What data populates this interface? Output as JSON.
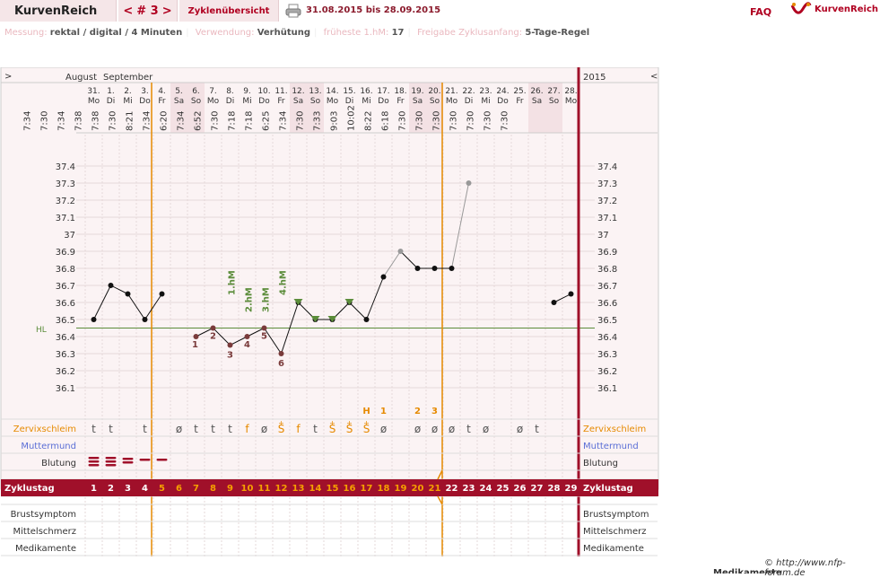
{
  "app": {
    "brand": "KurvenReich",
    "faq": "FAQ",
    "logo_text": "KurvenReich"
  },
  "nav": {
    "prev": "<",
    "cycle": "# 3",
    "next": ">",
    "overview": "Zyklenübersicht"
  },
  "daterange": "31.08.2015 bis 28.09.2015",
  "info": {
    "measure_label": "Messung:",
    "measure_value": "rektal / digital / 4 Minuten",
    "use_label": "Verwendung:",
    "use_value": "Verhütung",
    "earliest_label": "früheste 1.hM:",
    "earliest_value": "17",
    "release_label": "Freigabe Zyklusanfang:",
    "release_value": "5-Tage-Regel"
  },
  "chart": {
    "year": "2015",
    "left_arrow": ">",
    "right_arrow": "<",
    "month_aug": "August",
    "month_sep": "September",
    "hl_label": "HL",
    "dates": [
      "31.",
      "1.",
      "2.",
      "3.",
      "4.",
      "5.",
      "6.",
      "7.",
      "8.",
      "9.",
      "10.",
      "11.",
      "12.",
      "13.",
      "14.",
      "15.",
      "16.",
      "17.",
      "18.",
      "19.",
      "20.",
      "21.",
      "22.",
      "23.",
      "24.",
      "25.",
      "26.",
      "27.",
      "28."
    ],
    "weekdays": [
      "Mo",
      "Di",
      "Mi",
      "Do",
      "Fr",
      "Sa",
      "So",
      "Mo",
      "Di",
      "Mi",
      "Do",
      "Fr",
      "Sa",
      "So",
      "Mo",
      "Di",
      "Mi",
      "Do",
      "Fr",
      "Sa",
      "So",
      "Mo",
      "Di",
      "Mi",
      "Do",
      "Fr",
      "Sa",
      "So",
      "Mo"
    ],
    "times": [
      "7:34",
      "7:30",
      "7:34",
      "7:38",
      "7:38",
      "7:30",
      "8:21",
      "7:34",
      "6:20",
      "7:34",
      "6:52",
      "7:30",
      "7:18",
      "7:18",
      "6:25",
      "7:34",
      "7:30",
      "7:33",
      "9:03",
      "10:02",
      "8:22",
      "6:18",
      "7:30",
      "7:30",
      "7:30",
      "7:30",
      "7:30",
      "7:30",
      "7:30"
    ],
    "temps": [
      36.5,
      36.7,
      36.65,
      36.5,
      36.65,
      null,
      36.4,
      36.45,
      36.35,
      36.4,
      36.45,
      36.3,
      36.6,
      36.5,
      36.5,
      36.6,
      36.5,
      36.75,
      36.9,
      36.8,
      36.8,
      36.8,
      37.3,
      null,
      null,
      null,
      null,
      36.6,
      36.65
    ],
    "temp_excluded": [
      false,
      false,
      false,
      false,
      false,
      false,
      true,
      true,
      true,
      true,
      true,
      true,
      false,
      false,
      false,
      false,
      false,
      false,
      true,
      false,
      false,
      false,
      true,
      false,
      false,
      false,
      false,
      false,
      false
    ],
    "y_ticks": [
      "37.4",
      "37.3",
      "37.2",
      "37.1",
      "37",
      "36.9",
      "36.8",
      "36.7",
      "36.6",
      "36.5",
      "36.4",
      "36.3",
      "36.2",
      "36.1"
    ],
    "low_labels": [
      {
        "day": 6,
        "text": "1"
      },
      {
        "day": 7,
        "text": "2"
      },
      {
        "day": 8,
        "text": "3"
      },
      {
        "day": 9,
        "text": "4"
      },
      {
        "day": 10,
        "text": "5"
      },
      {
        "day": 11,
        "text": "6"
      }
    ],
    "hm_labels": [
      {
        "day": 12,
        "text": "1.hM"
      },
      {
        "day": 13,
        "text": "2.hM"
      },
      {
        "day": 14,
        "text": "3.hM"
      },
      {
        "day": 15,
        "text": "4.hM"
      }
    ],
    "peak_marks": [
      {
        "day": 16,
        "text": "H"
      },
      {
        "day": 17,
        "text": "1"
      },
      {
        "day": 19,
        "text": "2"
      },
      {
        "day": 20,
        "text": "3"
      }
    ],
    "mucus": [
      "t",
      "t",
      "",
      "t",
      "",
      "ø",
      "t",
      "t",
      "t",
      "f",
      "ø",
      "S",
      "f",
      "t",
      "S",
      "S",
      "S",
      "ø",
      "",
      "ø",
      "ø",
      "ø",
      "t",
      "ø",
      "",
      "ø",
      "t",
      "",
      ""
    ],
    "mucus_plus": [
      false,
      false,
      false,
      false,
      false,
      false,
      false,
      false,
      false,
      false,
      false,
      true,
      false,
      false,
      true,
      true,
      true,
      false,
      false,
      false,
      false,
      false,
      false,
      false,
      false,
      false,
      false,
      false,
      false
    ],
    "bleeding": [
      3,
      3,
      2,
      1,
      1,
      0,
      0,
      0,
      0,
      0,
      0,
      0,
      0,
      0,
      0,
      0,
      0,
      0,
      0,
      0,
      0,
      0,
      0,
      0,
      0,
      0,
      0,
      0,
      0
    ],
    "cycle_days": [
      "1",
      "2",
      "3",
      "4",
      "5",
      "6",
      "7",
      "8",
      "9",
      "10",
      "11",
      "12",
      "13",
      "14",
      "15",
      "16",
      "17",
      "18",
      "19",
      "20",
      "21",
      "22",
      "23",
      "24",
      "25",
      "26",
      "27",
      "28",
      "29"
    ],
    "rows": {
      "mucus": "Zervixschleim",
      "cervix": "Muttermund",
      "bleeding": "Blutung",
      "cycleday": "Zyklustag",
      "breast": "Brustsymptom",
      "midpain": "Mittelschmerz",
      "meds": "Medikamente"
    },
    "colors": {
      "accent": "#a0102a",
      "orange": "#e68a00",
      "green": "#5b8c3a",
      "cervix_blue": "#5b6fd6",
      "grid": "#ddd",
      "bg_pink": "#fbf3f4",
      "weekend": "#f3e1e4"
    }
  },
  "footer": {
    "copyright": "© http://www.nfp-forum.de",
    "cut_text": "Medikamente"
  }
}
